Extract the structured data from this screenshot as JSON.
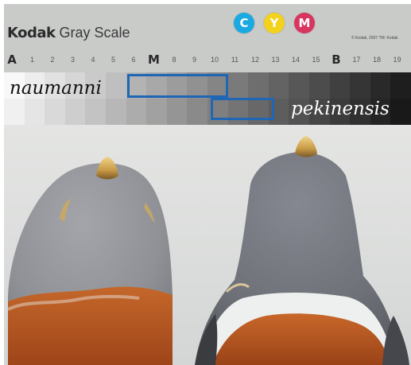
{
  "card": {
    "brand_bold": "Kodak",
    "brand_regular": " Gray Scale",
    "copyright": "© Kodak, 2007  TM: Kodak",
    "color_patches": [
      {
        "letter": "C",
        "color": "#1aa9e0"
      },
      {
        "letter": "Y",
        "color": "#f3d21d"
      },
      {
        "letter": "M",
        "color": "#d8355f"
      }
    ],
    "scale_labels": [
      "A",
      "1",
      "2",
      "3",
      "4",
      "5",
      "6",
      "M",
      "8",
      "9",
      "10",
      "11",
      "12",
      "13",
      "14",
      "15",
      "B",
      "17",
      "18",
      "19"
    ],
    "highlight_color": "#1f66b5"
  },
  "labels": {
    "naumanni": "naumanni",
    "pekinensis": "pekinensis"
  },
  "photo": {
    "background_color": "#dcdedd",
    "subjects": [
      {
        "name": "naumanni",
        "head_color": "#8f9196",
        "breast_color": "#b3541f"
      },
      {
        "name": "pekinensis",
        "head_color": "#6e7178",
        "breast_color": "#b8581e"
      }
    ]
  }
}
